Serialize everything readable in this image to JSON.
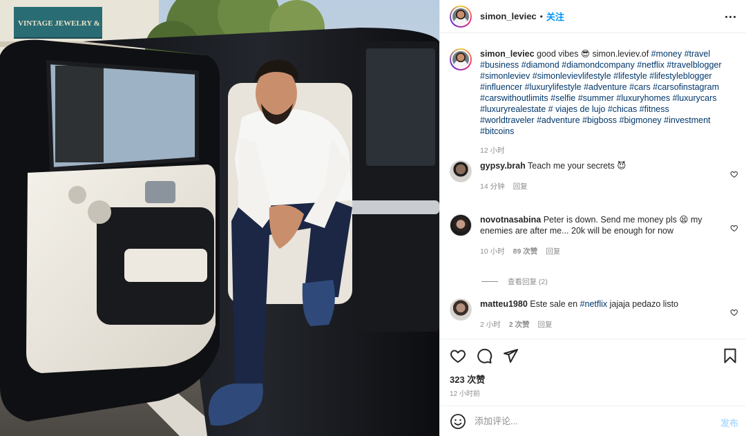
{
  "photo": {
    "store_sign": "VINTAGE JEWELRY & GIFTS"
  },
  "post": {
    "username": "simon_leviec",
    "dot": "•",
    "follow_label": "关注",
    "caption": {
      "username": "simon_leviec",
      "text": "good vibes 😎 simon.leviev.of ",
      "hashtags": "#money #travel #business #diamond #diamondcompany #netflix #travelblogger #simonleviev #simonlevievlifestyle #lifestyle #lifestyleblogger #influencer #luxurylifestyle #adventure #cars #carsofinstagram #carswithoutlimits #selfie #summer #luxuryhomes #luxurycars #luxuryrealestate # viajes de lujo #chicas #fitness #worldtraveler #adventure #bigboss #bigmoney #investment #bitcoins",
      "time": "12 小时"
    },
    "comments": [
      {
        "username": "gypsy.brah",
        "text": "Teach me your secrets 😈",
        "time": "14 分钟",
        "likes": "",
        "reply": "回复"
      },
      {
        "username": "novotnasabina",
        "text": "Peter is down. Send me money pls 😫 my enemies are after me... 20k will be enough for now",
        "time": "10 小时",
        "likes": "89 次赞",
        "reply": "回复"
      },
      {
        "username": "matteu1980",
        "text_before": "Este sale en ",
        "tag": "#netflix",
        "text_after": " jajaja pedazo listo",
        "time": "2 小时",
        "likes": "2 次赞",
        "reply": "回复"
      }
    ],
    "view_replies": "查看回复 (2)",
    "likes_count": "323 次赞",
    "posted_ago": "12 小时前",
    "add_comment_placeholder": "添加评论...",
    "post_label": "发布"
  },
  "icons": {
    "more": "more-options-icon",
    "like": "heart-icon",
    "comment": "comment-icon",
    "share": "share-icon",
    "save": "bookmark-icon",
    "emoji": "emoji-icon"
  }
}
